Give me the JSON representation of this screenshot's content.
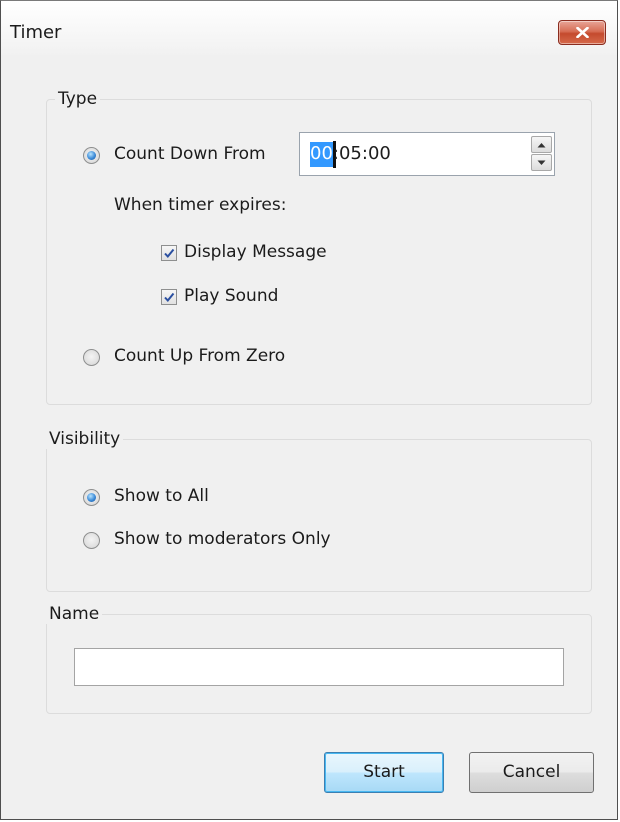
{
  "window": {
    "title": "Timer",
    "close_icon": "close-icon"
  },
  "type_group": {
    "legend": "Type",
    "count_down": {
      "label": "Count Down From",
      "checked": true
    },
    "time_value": {
      "hours": "00",
      "rest": ":05:00"
    },
    "expires_label": "When timer expires:",
    "display_message": {
      "label": "Display Message",
      "checked": true
    },
    "play_sound": {
      "label": "Play Sound",
      "checked": true
    },
    "count_up": {
      "label": "Count Up From Zero",
      "checked": false
    }
  },
  "visibility_group": {
    "legend": "Visibility",
    "show_all": {
      "label": "Show to All",
      "checked": true
    },
    "show_moderators": {
      "label": "Show to moderators Only",
      "checked": false
    }
  },
  "name_group": {
    "legend": "Name",
    "value": ""
  },
  "buttons": {
    "start": "Start",
    "cancel": "Cancel"
  },
  "colors": {
    "selection": "#3399ff",
    "radio_accent": "#3c8bd8",
    "close_button": "#c44a2e"
  }
}
